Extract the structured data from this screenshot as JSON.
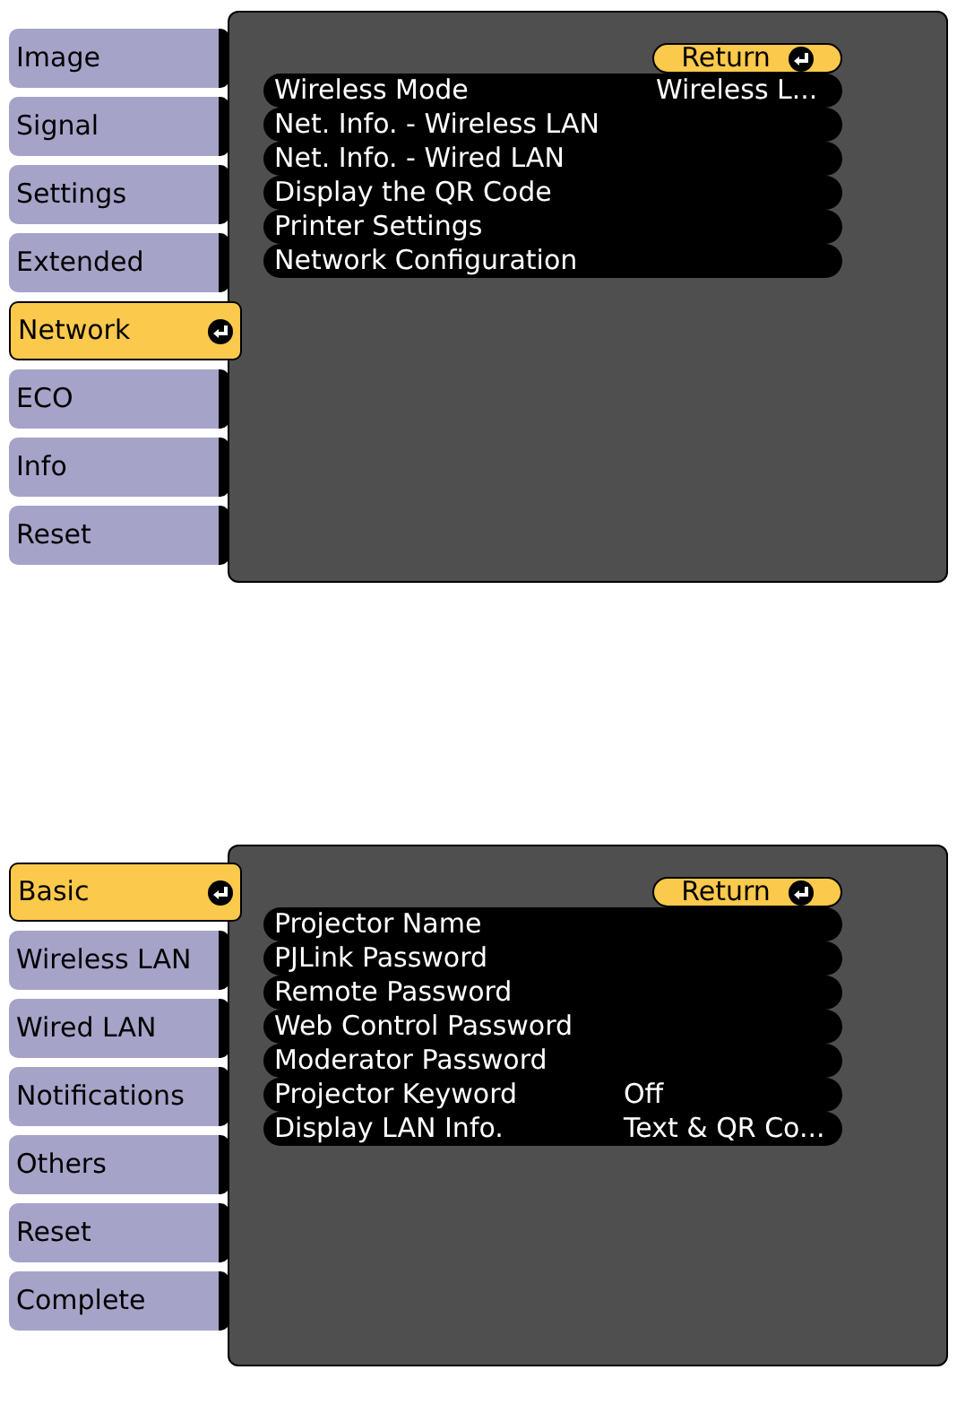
{
  "menus": [
    {
      "tabs": [
        {
          "label": "Image",
          "selected": false
        },
        {
          "label": "Signal",
          "selected": false
        },
        {
          "label": "Settings",
          "selected": false
        },
        {
          "label": "Extended",
          "selected": false
        },
        {
          "label": "Network",
          "selected": true
        },
        {
          "label": "ECO",
          "selected": false
        },
        {
          "label": "Info",
          "selected": false
        },
        {
          "label": "Reset",
          "selected": false
        }
      ],
      "return_button": "Return",
      "items": [
        {
          "label": "Wireless Mode",
          "value": "Wireless L..."
        },
        {
          "label": "Net. Info. - Wireless LAN"
        },
        {
          "label": "Net. Info. - Wired LAN"
        },
        {
          "label": "Display the QR Code"
        },
        {
          "label": "Printer Settings"
        },
        {
          "label": "Network Configuration"
        }
      ]
    },
    {
      "tabs": [
        {
          "label": "Basic",
          "selected": true
        },
        {
          "label": "Wireless LAN",
          "selected": false
        },
        {
          "label": "Wired LAN",
          "selected": false
        },
        {
          "label": "Notifications",
          "selected": false
        },
        {
          "label": "Others",
          "selected": false
        },
        {
          "label": "Reset",
          "selected": false
        },
        {
          "label": "Complete",
          "selected": false
        }
      ],
      "return_button": "Return",
      "items": [
        {
          "label": "Projector Name"
        },
        {
          "label": "PJLink Password"
        },
        {
          "label": "Remote Password"
        },
        {
          "label": "Web Control Password"
        },
        {
          "label": "Moderator Password"
        },
        {
          "label": "Projector Keyword",
          "value": "Off"
        },
        {
          "label": "Display LAN Info.",
          "value": "Text & QR Co..."
        }
      ]
    }
  ]
}
